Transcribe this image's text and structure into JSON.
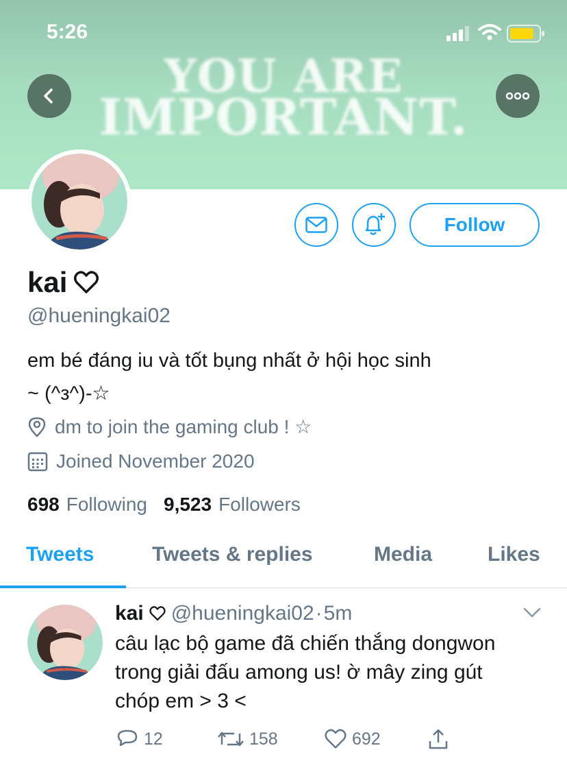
{
  "status_bar": {
    "time": "5:26"
  },
  "banner": {
    "line1": "YOU ARE",
    "line2": "IMPORTANT."
  },
  "profile": {
    "display_name": "kai",
    "handle": "@hueningkai02",
    "bio_line1": "em bé đáng iu và tốt bụng nhất ở hội học sinh",
    "bio_line2": "~ (^з^)-☆",
    "location": "dm to join the gaming club ! ☆",
    "joined": "Joined November 2020",
    "following_count": "698",
    "following_label": "Following",
    "followers_count": "9,523",
    "followers_label": "Followers"
  },
  "actions": {
    "follow_label": "Follow"
  },
  "tabs": [
    {
      "label": "Tweets",
      "active": true
    },
    {
      "label": "Tweets & replies",
      "active": false
    },
    {
      "label": "Media",
      "active": false
    },
    {
      "label": "Likes",
      "active": false
    }
  ],
  "tweet": {
    "name": "kai",
    "handle": "@hueningkai02",
    "dot": "·",
    "time": "5m",
    "line1": "câu lạc bộ game đã chiến thắng dongwon",
    "line2": "trong giải đấu among us! ờ mây zing gút",
    "line3": "chóp em > 3 <",
    "replies": "12",
    "retweets": "158",
    "likes": "692"
  },
  "colors": {
    "accent": "#1da1f2",
    "banner": "#aee7c7",
    "muted_text": "#657786",
    "battery": "#ffd60a"
  },
  "icons": [
    "back-arrow-icon",
    "more-icon",
    "mail-icon",
    "bell-plus-icon",
    "heart-outline-icon",
    "location-pin-icon",
    "calendar-icon",
    "chevron-down-icon",
    "reply-icon",
    "retweet-icon",
    "like-icon",
    "share-icon"
  ]
}
